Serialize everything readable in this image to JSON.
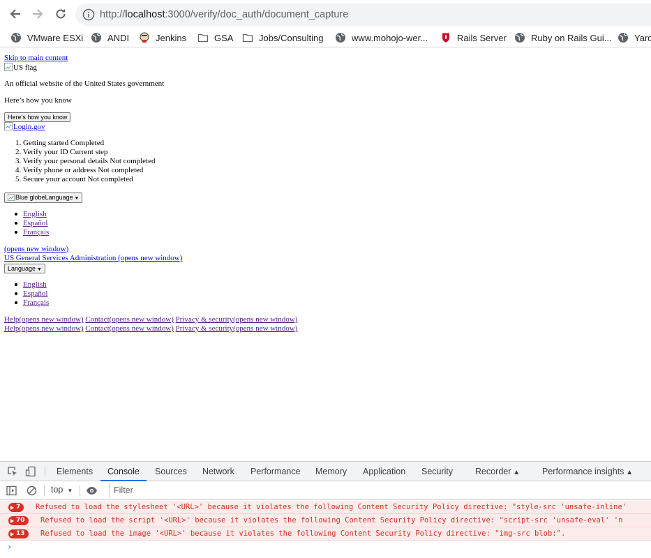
{
  "browser": {
    "url_host": "localhost",
    "url_rest": ":3000/verify/doc_auth/document_capture",
    "url_scheme": "http://",
    "bookmarks": [
      {
        "label": "VMware ESXi",
        "icon": "globe-icon"
      },
      {
        "label": "ANDI",
        "icon": "globe-icon"
      },
      {
        "label": "Jenkins",
        "icon": "jenkins-icon"
      },
      {
        "label": "GSA",
        "icon": "folder-icon"
      },
      {
        "label": "Jobs/Consulting",
        "icon": "folder-icon"
      },
      {
        "label": "www.mohojo-wer...",
        "icon": "globe-icon"
      },
      {
        "label": "Rails Server",
        "icon": "shield-icon"
      },
      {
        "label": "Ruby on Rails Gui...",
        "icon": "globe-icon"
      },
      {
        "label": "Yard",
        "icon": "globe-icon"
      }
    ]
  },
  "page": {
    "skip_link": "Skip to main content",
    "flag_alt": "US flag",
    "official_text": "An official website of the United States government",
    "how_you_know_text": "Here’s how you know",
    "how_you_know_button": "Here’s how you know",
    "logo_alt": "Login.gov",
    "steps": [
      "1. Getting started Completed",
      "2. Verify your ID Current step",
      "3. Verify your personal details Not completed",
      "4. Verify phone or address Not completed",
      "5. Secure your account Not completed"
    ],
    "language_button_1": {
      "img_alt": "Blue globe",
      "label": "Language"
    },
    "languages_1": [
      "English",
      "Español",
      "Français"
    ],
    "opens_new_window_link": " (opens new window)",
    "gsa_link": " US General Services Administration (opens new window)",
    "language_button_2": "Language",
    "languages_2": [
      "English",
      "Español",
      "Français"
    ],
    "footer_links_row1": [
      "Help(opens new window)",
      "Contact(opens new window)",
      "Privacy & security(opens new window)"
    ],
    "footer_links_row2": [
      "Help(opens new window)",
      "Contact(opens new window)",
      "Privacy & security(opens new window)"
    ]
  },
  "devtools": {
    "tabs": [
      "Elements",
      "Console",
      "Sources",
      "Network",
      "Performance",
      "Memory",
      "Application",
      "Security",
      "Recorder",
      "Performance insights"
    ],
    "active_tab": "Console",
    "context": "top",
    "filter_placeholder": "Filter",
    "messages": [
      {
        "count": "7",
        "text": "Refused to load the stylesheet '<URL>' because it violates the following Content Security Policy directive: \"style-src 'unsafe-inline'"
      },
      {
        "count": "70",
        "text": "Refused to load the script '<URL>' because it violates the following Content Security Policy directive: \"script-src 'unsafe-eval' 'n"
      },
      {
        "count": "13",
        "text": "Refused to load the image '<URL>' because it violates the following Content Security Policy directive: \"img-src blob:\"."
      }
    ],
    "prompt": "›"
  },
  "colors": {
    "link": "#0000ee",
    "visited": "#551a8b",
    "error": "#d93025",
    "devtools_accent": "#1a73e8"
  }
}
